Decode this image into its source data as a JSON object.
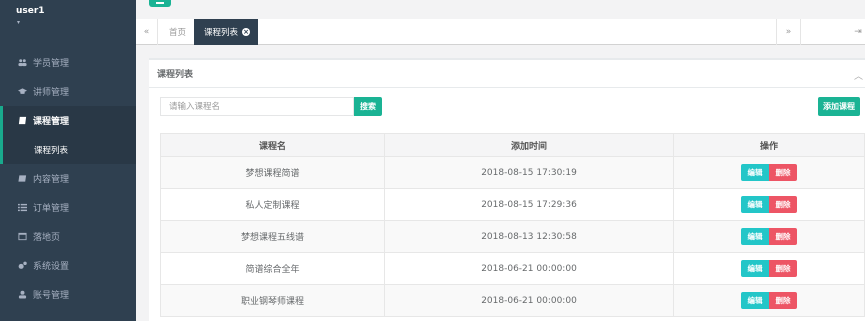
{
  "user": {
    "name": "user1",
    "caret": "▾"
  },
  "sidebar": {
    "items": [
      {
        "label": "学员管理",
        "icon": "users-icon"
      },
      {
        "label": "讲师管理",
        "icon": "graduation-cap-icon"
      },
      {
        "label": "课程管理",
        "icon": "book-icon",
        "active": true
      },
      {
        "label": "内容管理",
        "icon": "book-open-icon"
      },
      {
        "label": "订单管理",
        "icon": "list-icon"
      },
      {
        "label": "落地页",
        "icon": "window-icon"
      },
      {
        "label": "系统设置",
        "icon": "cogs-icon"
      },
      {
        "label": "账号管理",
        "icon": "user-icon"
      }
    ],
    "subitem": "课程列表"
  },
  "tabs": {
    "home": "首页",
    "active": "课程列表",
    "close_glyph": "×"
  },
  "panel": {
    "title": "课程列表",
    "search_placeholder": "请输入课程名",
    "search_button": "搜索",
    "add_button": "添加课程"
  },
  "table": {
    "headers": [
      "课程名",
      "添加时间",
      "操作"
    ],
    "rows": [
      {
        "name": "梦想课程简谱",
        "time": "2018-08-15 17:30:19"
      },
      {
        "name": "私人定制课程",
        "time": "2018-08-15 17:29:36"
      },
      {
        "name": "梦想课程五线谱",
        "time": "2018-08-13 12:30:58"
      },
      {
        "name": "简谱综合全年",
        "time": "2018-06-21 00:00:00"
      },
      {
        "name": "职业钢琴师课程",
        "time": "2018-06-21 00:00:00"
      }
    ],
    "edit_label": "编辑",
    "delete_label": "删除"
  },
  "colors": {
    "sidebar": "#2f4050",
    "primary": "#1ab394",
    "info": "#23c6c8",
    "danger": "#ed5565"
  }
}
